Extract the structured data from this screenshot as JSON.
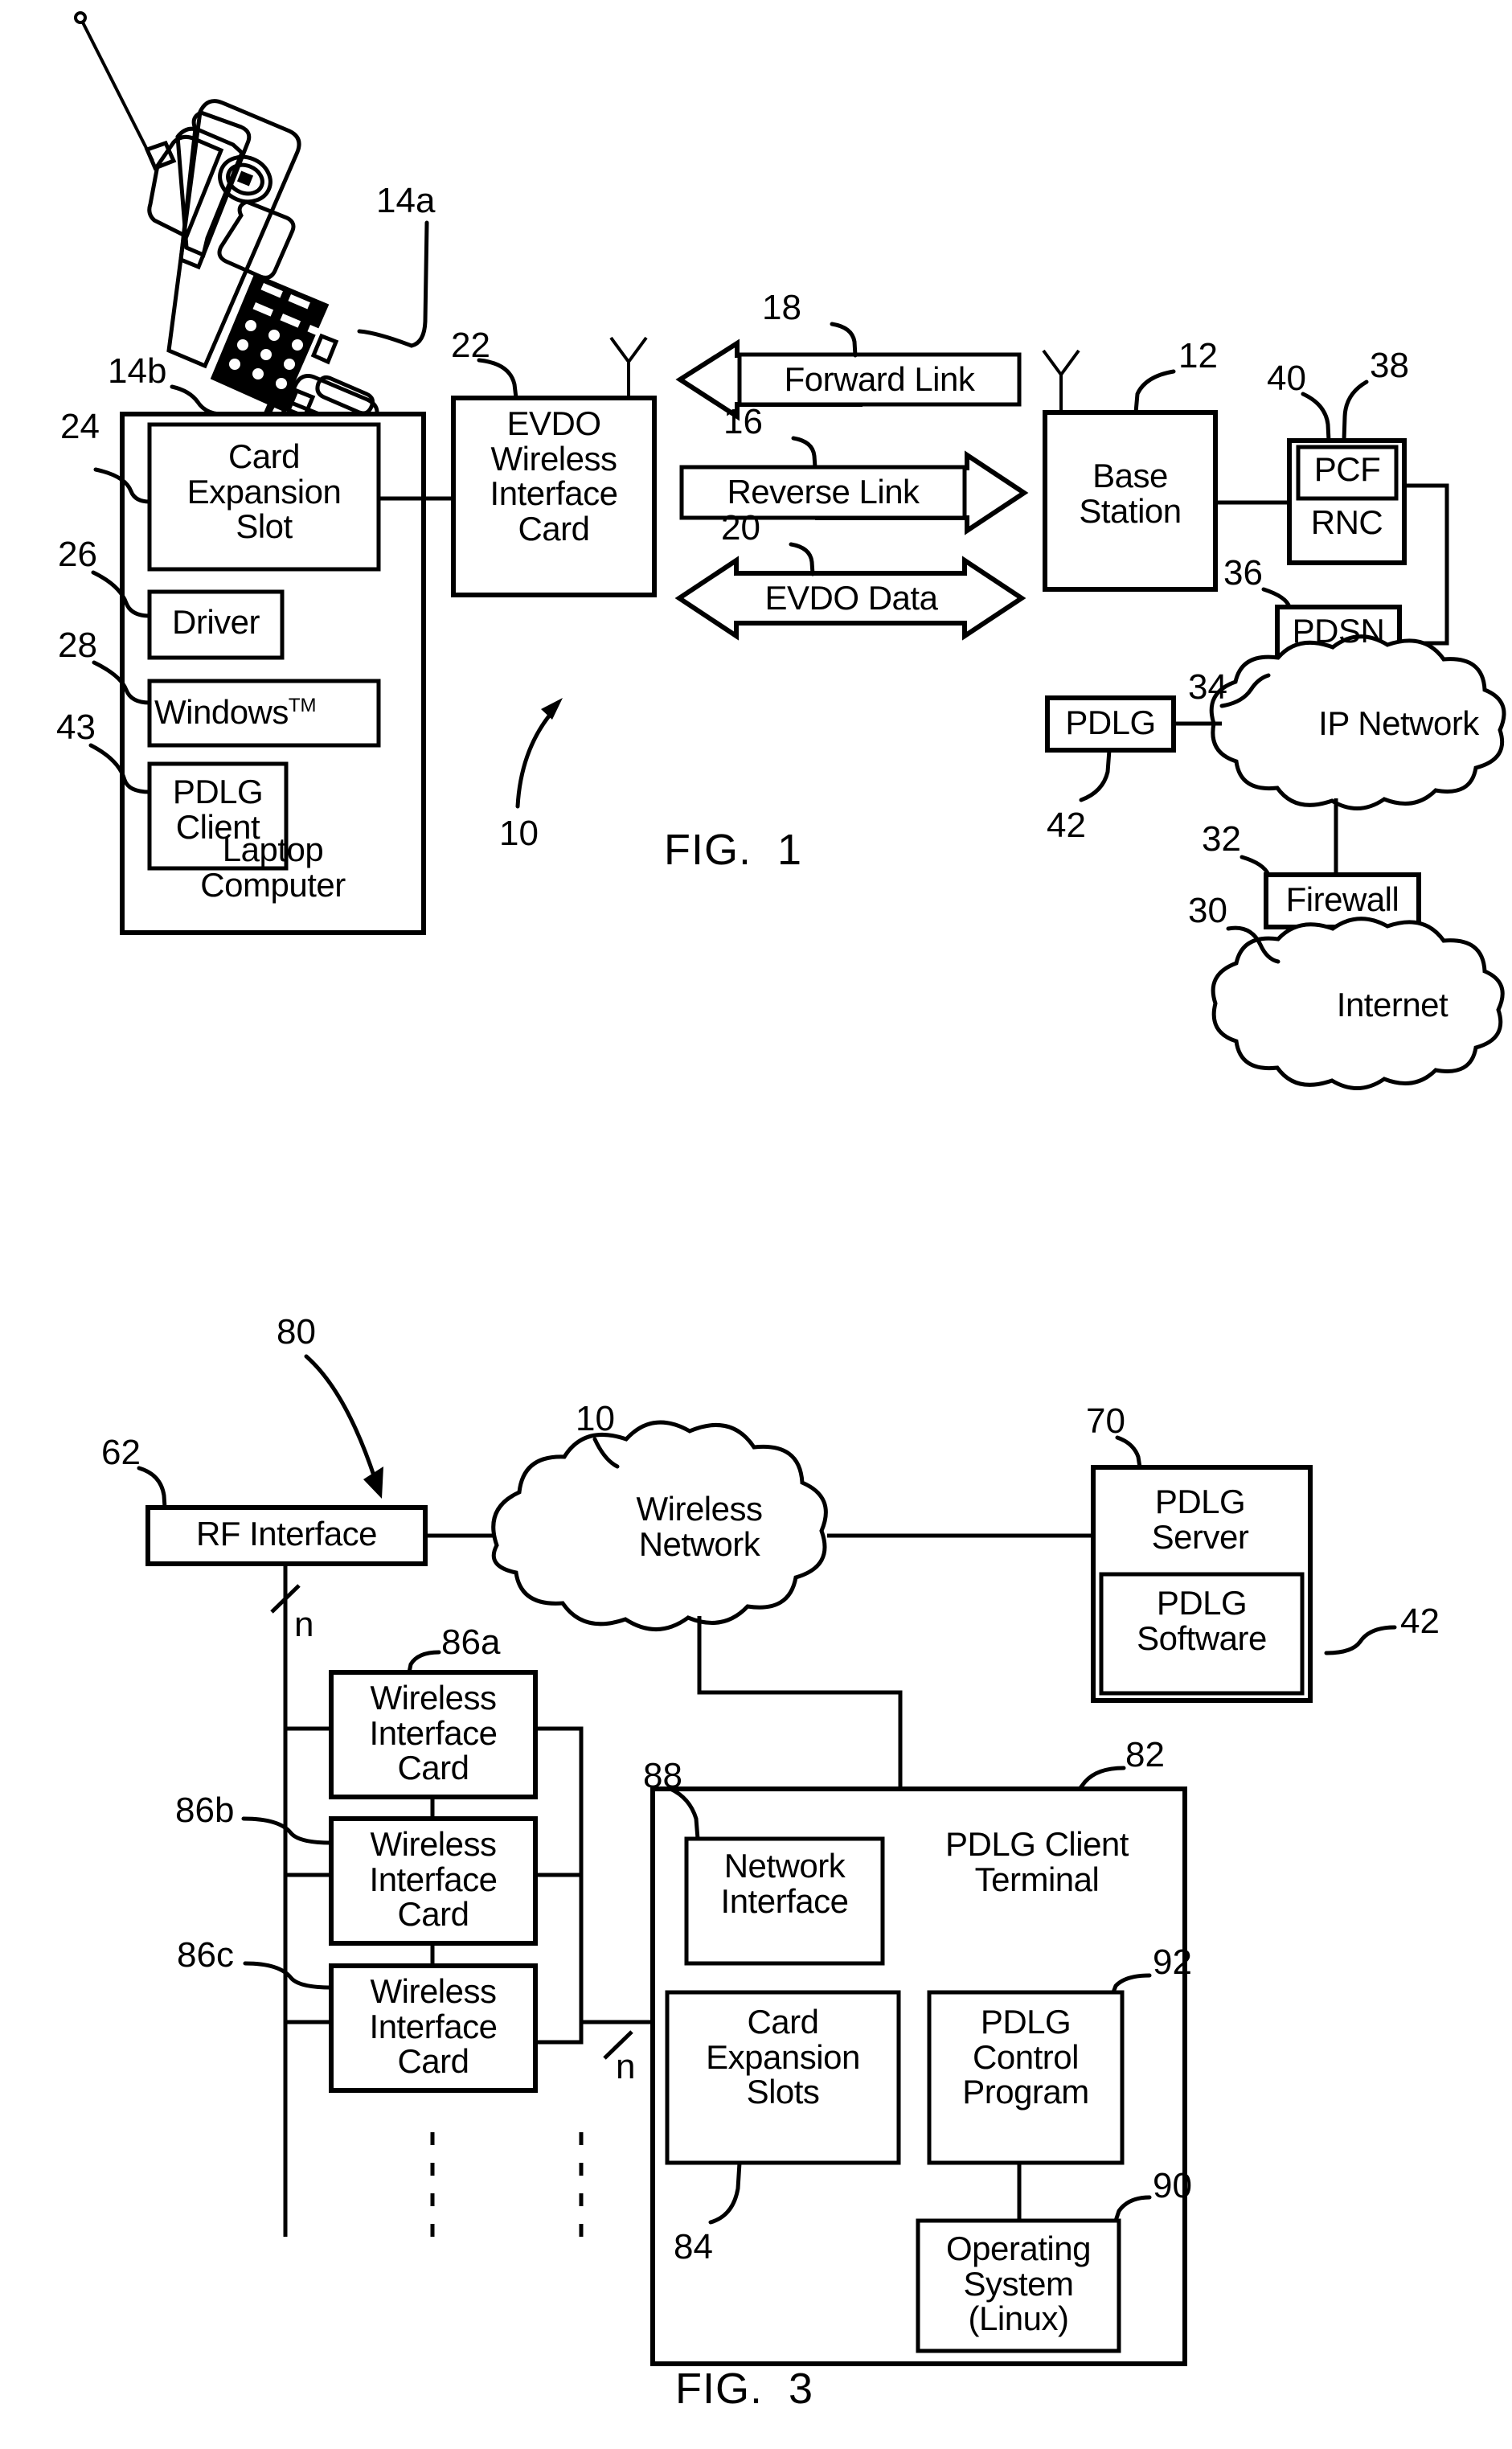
{
  "figures": [
    {
      "id": "fig1",
      "caption": "FIG.  1",
      "system_ref": "10",
      "devices": {
        "cellphone_ref": "14a",
        "laptop": {
          "ref": "14b",
          "title": "Laptop\nComputer",
          "components": [
            {
              "ref": "24",
              "label": "Card\nExpansion\nSlot"
            },
            {
              "ref": "26",
              "label": "Driver"
            },
            {
              "ref": "28",
              "label": "Windows",
              "superscript": "TM"
            },
            {
              "ref": "43",
              "label": "PDLG\nClient"
            }
          ]
        },
        "wireless_card": {
          "ref": "22",
          "label": "EVDO\nWireless\nInterface\nCard"
        }
      },
      "links": [
        {
          "ref": "18",
          "label": "Forward Link",
          "direction": "left"
        },
        {
          "ref": "16",
          "label": "Reverse Link",
          "direction": "right"
        },
        {
          "ref": "20",
          "label": "EVDO Data",
          "direction": "both"
        }
      ],
      "network": [
        {
          "ref": "12",
          "label": "Base\nStation",
          "type": "box"
        },
        {
          "ref": "38",
          "label": "PCF",
          "type": "box"
        },
        {
          "ref": "40",
          "label": "RNC",
          "type": "box"
        },
        {
          "ref": "36",
          "label": "PDSN",
          "type": "box"
        },
        {
          "ref": "34",
          "label": "IP Network",
          "type": "cloud"
        },
        {
          "ref": "42",
          "label": "PDLG",
          "type": "box"
        },
        {
          "ref": "32",
          "label": "Firewall",
          "type": "box"
        },
        {
          "ref": "30",
          "label": "Internet",
          "type": "cloud"
        }
      ]
    },
    {
      "id": "fig3",
      "caption": "FIG.  3",
      "system_ref": "80",
      "nodes": [
        {
          "ref": "62",
          "label": "RF Interface",
          "type": "box"
        },
        {
          "ref": "10",
          "label": "Wireless\nNetwork",
          "type": "cloud"
        },
        {
          "ref": "70",
          "label": "PDLG\nServer",
          "type": "box"
        },
        {
          "ref": "42",
          "label": "PDLG\nSoftware",
          "type": "box"
        },
        {
          "ref": "86a",
          "label": "Wireless\nInterface\nCard",
          "type": "box"
        },
        {
          "ref": "86b",
          "label": "Wireless\nInterface\nCard",
          "type": "box"
        },
        {
          "ref": "86c",
          "label": "Wireless\nInterface\nCard",
          "type": "box"
        },
        {
          "ref": "82",
          "label": "PDLG Client\nTerminal",
          "type": "box"
        },
        {
          "ref": "88",
          "label": "Network\nInterface",
          "type": "box"
        },
        {
          "ref": "84",
          "label": "Card\nExpansion\nSlots",
          "type": "box"
        },
        {
          "ref": "92",
          "label": "PDLG\nControl\nProgram",
          "type": "box"
        },
        {
          "ref": "90",
          "label": "Operating\nSystem\n(Linux)",
          "type": "box"
        }
      ],
      "bus_labels": [
        "n",
        "n"
      ]
    }
  ],
  "colors": {
    "ink": "#000000",
    "paper": "#ffffff"
  }
}
